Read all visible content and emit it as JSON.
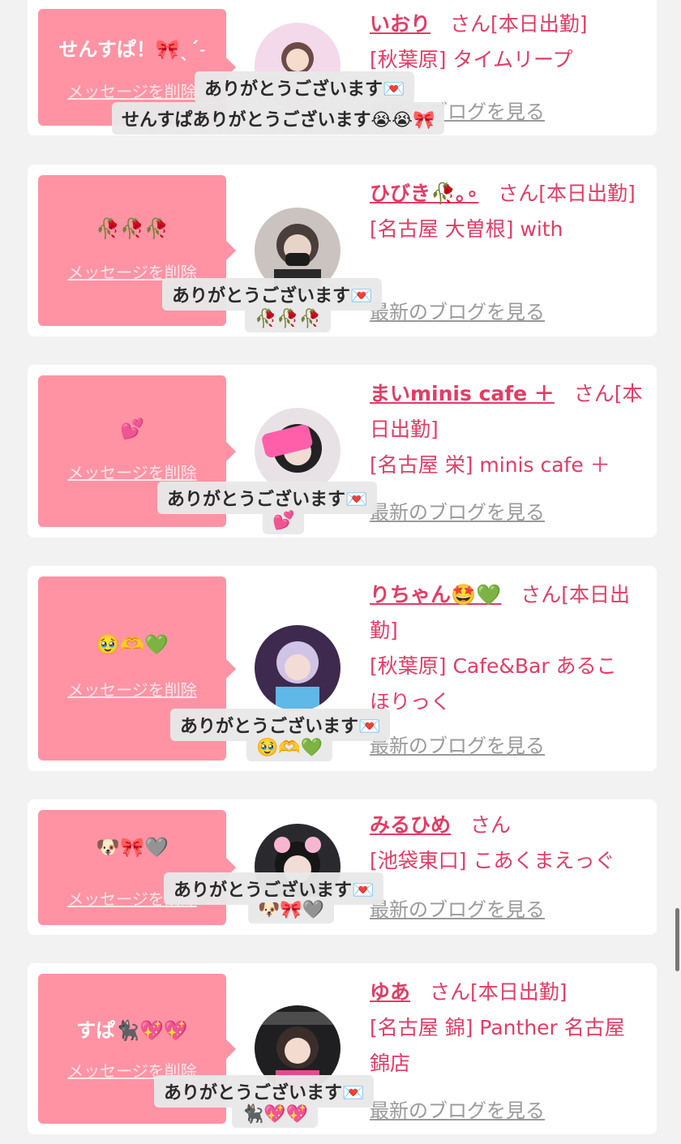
{
  "common": {
    "delete_label": "メッセージを削除",
    "blog_label": "最新のブログを見る",
    "thanks_label": "ありがとうございます💌"
  },
  "cards": [
    {
      "message": "せんすぱ！🎀ˎˊ˗",
      "name": "いおり",
      "status": "さん[本日出勤]",
      "shop": "[秋葉原] タイムリープ",
      "shop2": "",
      "reply": "せんすぱありがとうございます😭😭🎀",
      "avatar_color": "#f3d9ea"
    },
    {
      "message": "🥀🥀🥀",
      "name": "ひびき🥀｡∘",
      "status": "さん[本日出勤]",
      "shop": "[名古屋 大曽根] with",
      "shop2": "",
      "reply": "🥀🥀🥀",
      "avatar_color": "#cbc3c0"
    },
    {
      "message": "💕",
      "name": "まいminis cafe ＋",
      "status": "さん[本日出勤]",
      "shop": "[名古屋 栄] minis cafe ＋",
      "shop2": "",
      "reply": "💕",
      "avatar_color": "#e8e2e6"
    },
    {
      "message": "🥹🫶💚",
      "name": "りちゃん🤩💚",
      "status": "さん[本日出勤]",
      "shop": "[秋葉原] Cafe&Bar あるこ",
      "shop2": "ほりっく",
      "reply": "🥹🫶💚",
      "avatar_color": "#3d2a4e"
    },
    {
      "message": "🐶🎀🩶",
      "name": "みるひめ",
      "status": "さん",
      "shop": "[池袋東口] こあくまえっぐ",
      "shop2": "",
      "reply": "🐶🎀🩶",
      "avatar_color": "#2a2a2e"
    },
    {
      "message": "すぱ🐈‍⬛💖💖",
      "name": "ゆあ",
      "status": "さん[本日出勤]",
      "shop": "[名古屋 錦] Panther 名古屋",
      "shop2": "錦店",
      "reply": "🐈‍⬛💖💖",
      "avatar_color": "#1f1f22"
    }
  ]
}
